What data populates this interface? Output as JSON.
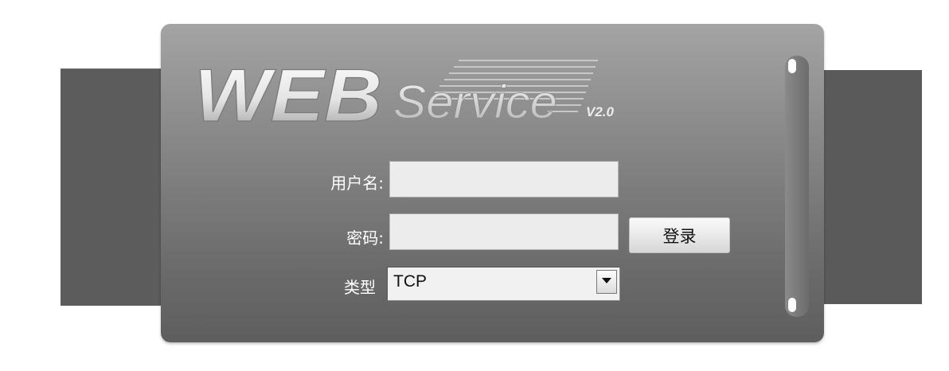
{
  "logo": {
    "word1": "WEB",
    "word2": "Service",
    "version": "V2.0"
  },
  "form": {
    "username_label": "用户名:",
    "password_label": "密码:",
    "type_label": "类型",
    "username_value": "",
    "password_value": "",
    "type_selected": "TCP",
    "login_button": "登录"
  },
  "icons": {
    "dropdown": "chevron-down-icon"
  },
  "colors": {
    "panel_top": "#a4a4a4",
    "panel_bottom": "#5e5e5e",
    "band": "#5c5c5c",
    "input_bg": "#ececec",
    "label_text": "#ffffff"
  }
}
